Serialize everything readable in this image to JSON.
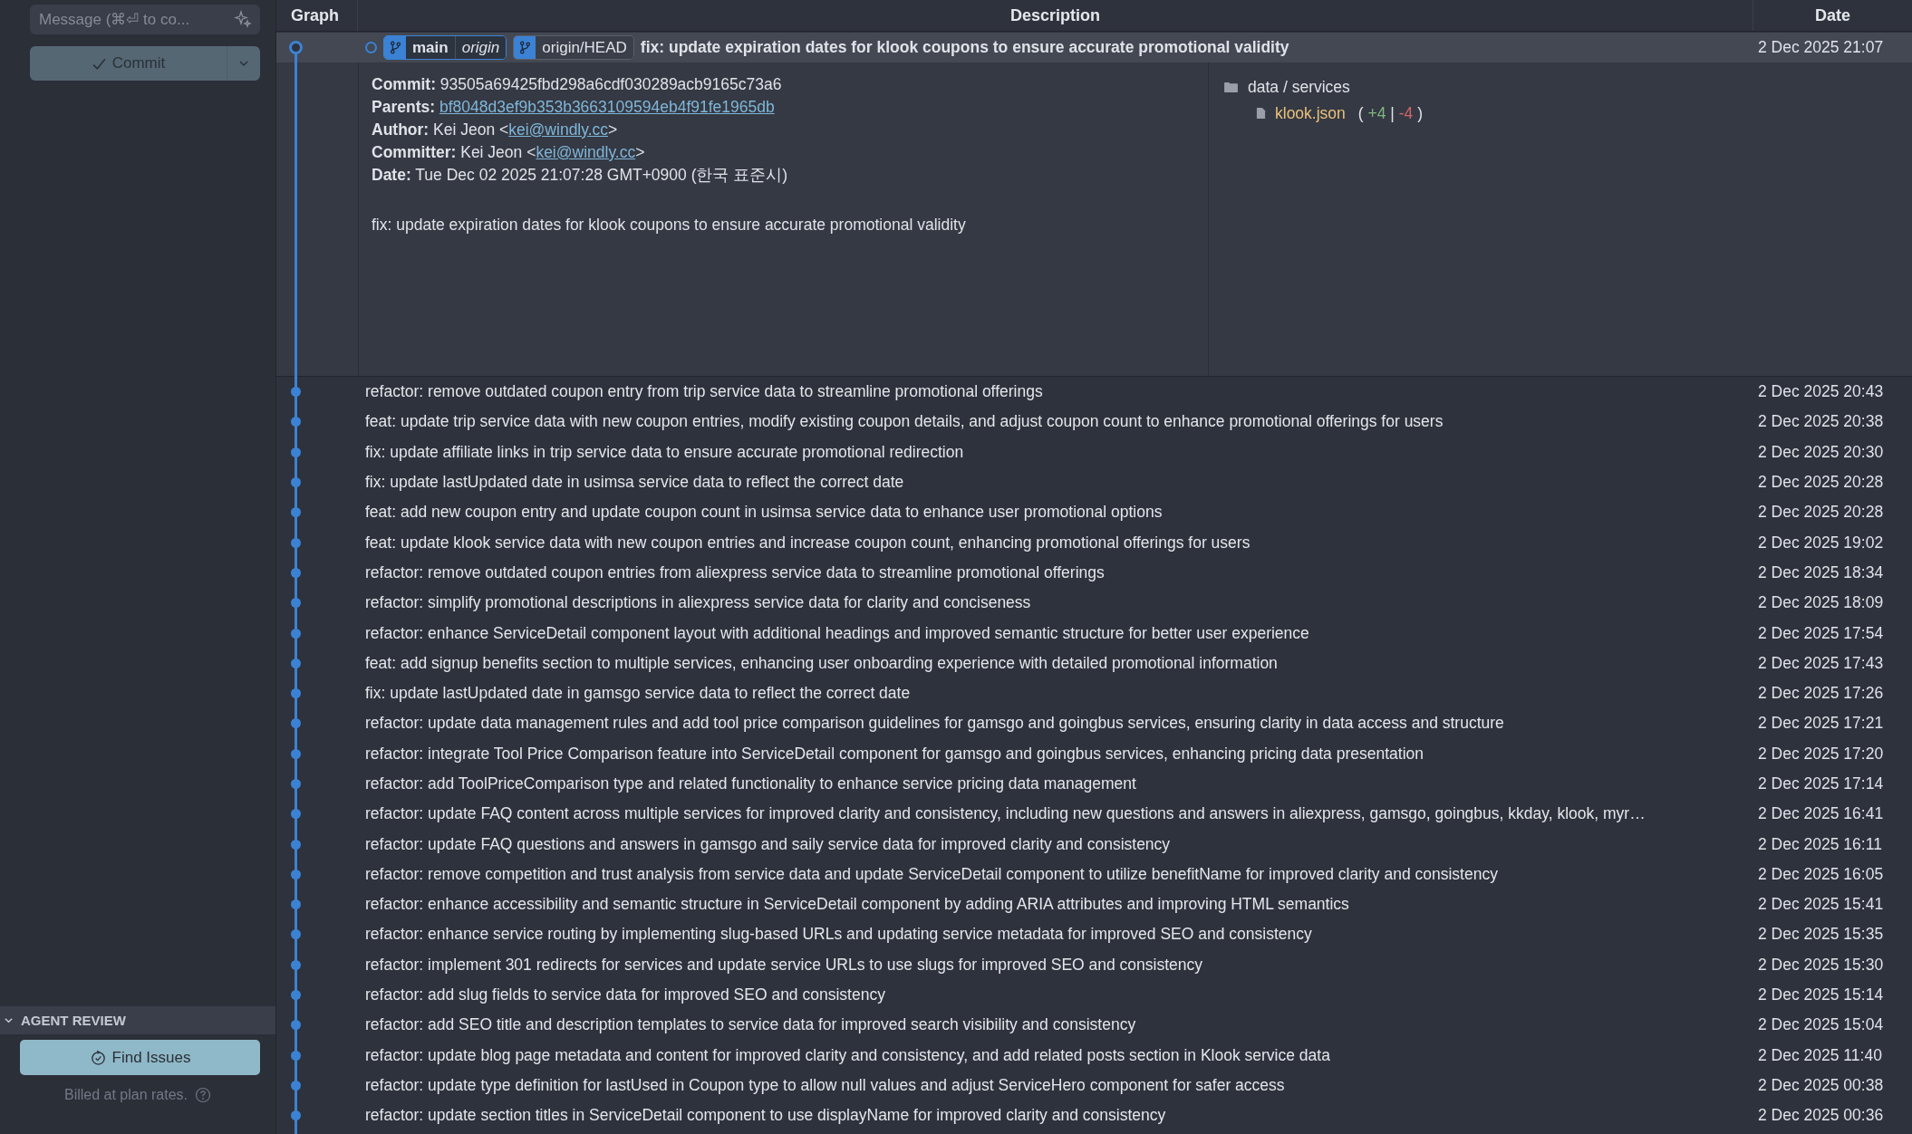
{
  "sidebar": {
    "message_field": {
      "placeholder": "Message (⌘⏎ to co..."
    },
    "commit_button": {
      "label": "Commit",
      "disabled": true
    },
    "agent_review": {
      "title": "AGENT REVIEW",
      "expanded": true,
      "button": "Find Issues",
      "note": "Billed at plan rates."
    }
  },
  "table": {
    "columns": [
      "Graph",
      "Description",
      "Date"
    ],
    "selected_commit": {
      "branches": [
        {
          "name": "main",
          "remote": "origin"
        },
        {
          "name": "origin/HEAD"
        }
      ],
      "message": "fix: update expiration dates for klook coupons to ensure accurate promotional validity",
      "date": "2 Dec 2025 21:07",
      "details": {
        "commit": {
          "label": "Commit:",
          "value": "93505a69425fbd298a6cdf030289acb9165c73a6"
        },
        "parents": {
          "label": "Parents:",
          "value": "bf8048d3ef9b353b3663109594eb4f91fe1965db"
        },
        "author": {
          "label": "Author:",
          "name": "Kei Jeon",
          "open": "<",
          "email": "kei@windly.cc",
          "close": ">"
        },
        "committer": {
          "label": "Committer:",
          "name": "Kei Jeon",
          "open": "<",
          "email": "kei@windly.cc",
          "close": ">"
        },
        "date": {
          "label": "Date:",
          "value": "Tue Dec 02 2025 21:07:28 GMT+0900 (한국 표준시)"
        },
        "body": "fix: update expiration dates for klook coupons to ensure accurate promotional validity"
      },
      "files": {
        "folder": "data / services",
        "items": [
          {
            "name": "klook.json",
            "open": "(",
            "added": "+4",
            "separator": "|",
            "removed": "-4",
            "close": ")"
          }
        ]
      }
    },
    "rows": [
      {
        "message": "refactor: remove outdated coupon entry from trip service data to streamline promotional offerings",
        "date": "2 Dec 2025 20:43"
      },
      {
        "message": "feat: update trip service data with new coupon entries, modify existing coupon details, and adjust coupon count to enhance promotional offerings for users",
        "date": "2 Dec 2025 20:38"
      },
      {
        "message": "fix: update affiliate links in trip service data to ensure accurate promotional redirection",
        "date": "2 Dec 2025 20:30"
      },
      {
        "message": "fix: update lastUpdated date in usimsa service data to reflect the correct date",
        "date": "2 Dec 2025 20:28"
      },
      {
        "message": "feat: add new coupon entry and update coupon count in usimsa service data to enhance user promotional options",
        "date": "2 Dec 2025 20:28"
      },
      {
        "message": "feat: update klook service data with new coupon entries and increase coupon count, enhancing promotional offerings for users",
        "date": "2 Dec 2025 19:02"
      },
      {
        "message": "refactor: remove outdated coupon entries from aliexpress service data to streamline promotional offerings",
        "date": "2 Dec 2025 18:34"
      },
      {
        "message": "refactor: simplify promotional descriptions in aliexpress service data for clarity and conciseness",
        "date": "2 Dec 2025 18:09"
      },
      {
        "message": "refactor: enhance ServiceDetail component layout with additional headings and improved semantic structure for better user experience",
        "date": "2 Dec 2025 17:54"
      },
      {
        "message": "feat: add signup benefits section to multiple services, enhancing user onboarding experience with detailed promotional information",
        "date": "2 Dec 2025 17:43"
      },
      {
        "message": "fix: update lastUpdated date in gamsgo service data to reflect the correct date",
        "date": "2 Dec 2025 17:26"
      },
      {
        "message": "refactor: update data management rules and add tool price comparison guidelines for gamsgo and goingbus services, ensuring clarity in data access and structure",
        "date": "2 Dec 2025 17:21"
      },
      {
        "message": "refactor: integrate Tool Price Comparison feature into ServiceDetail component for gamsgo and goingbus services, enhancing pricing data presentation",
        "date": "2 Dec 2025 17:20"
      },
      {
        "message": "refactor: add ToolPriceComparison type and related functionality to enhance service pricing data management",
        "date": "2 Dec 2025 17:14"
      },
      {
        "message": "refactor: update FAQ content across multiple services for improved clarity and consistency, including new questions and answers in aliexpress, gamsgo, goingbus, kkday, klook, myr…",
        "date": "2 Dec 2025 16:41"
      },
      {
        "message": "refactor: update FAQ questions and answers in gamsgo and saily service data for improved clarity and consistency",
        "date": "2 Dec 2025 16:11"
      },
      {
        "message": "refactor: remove competition and trust analysis from service data and update ServiceDetail component to utilize benefitName for improved clarity and consistency",
        "date": "2 Dec 2025 16:05"
      },
      {
        "message": "refactor: enhance accessibility and semantic structure in ServiceDetail component by adding ARIA attributes and improving HTML semantics",
        "date": "2 Dec 2025 15:41"
      },
      {
        "message": "refactor: enhance service routing by implementing slug-based URLs and updating service metadata for improved SEO and consistency",
        "date": "2 Dec 2025 15:35"
      },
      {
        "message": "refactor: implement 301 redirects for services and update service URLs to use slugs for improved SEO and consistency",
        "date": "2 Dec 2025 15:30"
      },
      {
        "message": "refactor: add slug fields to service data for improved SEO and consistency",
        "date": "2 Dec 2025 15:14"
      },
      {
        "message": "refactor: add SEO title and description templates to service data for improved search visibility and consistency",
        "date": "2 Dec 2025 15:04"
      },
      {
        "message": "refactor: update blog page metadata and content for improved clarity and consistency, and add related posts section in Klook service data",
        "date": "2 Dec 2025 11:40"
      },
      {
        "message": "refactor: update type definition for lastUsed in Coupon type to allow null values and adjust ServiceHero component for safer access",
        "date": "2 Dec 2025 00:38"
      },
      {
        "message": "refactor: update section titles in ServiceDetail component to use displayName for improved clarity and consistency",
        "date": "2 Dec 2025 00:36"
      }
    ]
  }
}
